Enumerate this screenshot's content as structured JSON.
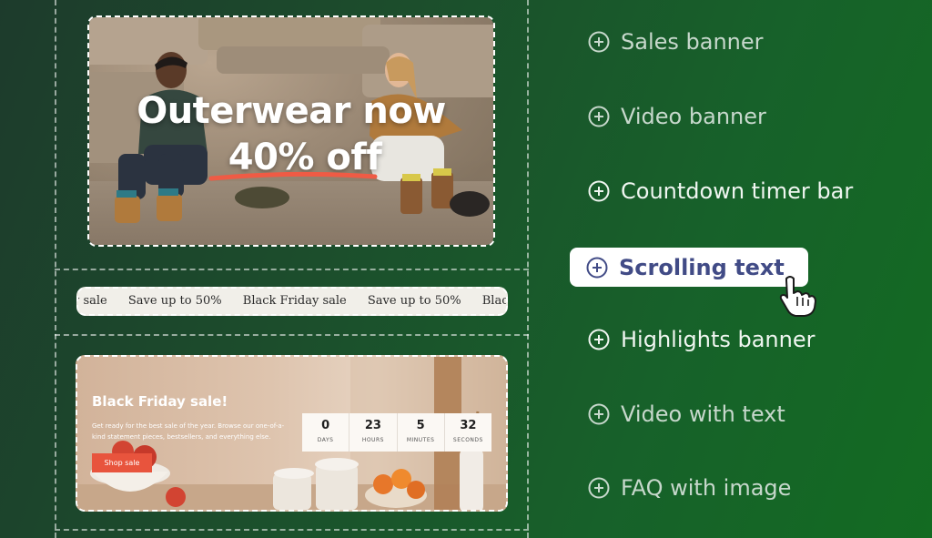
{
  "hero": {
    "line1": "Outerwear now",
    "line2": "40% off"
  },
  "ticker": {
    "items": [
      "y sale",
      "Save up to 50%",
      "Black Friday sale",
      "Save up to 50%",
      "Black Friday sale"
    ]
  },
  "promo": {
    "title": "Black Friday sale!",
    "description": "Get ready for the best sale of the year. Browse our one-of-a-kind statement pieces, bestsellers, and everything else.",
    "button_label": "Shop sale",
    "countdown": [
      {
        "value": "0",
        "unit": "DAYS"
      },
      {
        "value": "23",
        "unit": "HOURS"
      },
      {
        "value": "5",
        "unit": "MINUTES"
      },
      {
        "value": "32",
        "unit": "SECONDS"
      }
    ]
  },
  "section_menu": {
    "items": [
      {
        "label": "Sales banner",
        "icon": "plus-circle-icon"
      },
      {
        "label": "Video banner",
        "icon": "plus-circle-icon"
      },
      {
        "label": "Countdown timer bar",
        "icon": "plus-circle-icon"
      },
      {
        "label": "Scrolling text",
        "icon": "plus-circle-icon",
        "selected": true
      },
      {
        "label": "Highlights banner",
        "icon": "plus-circle-icon"
      },
      {
        "label": "Video with text",
        "icon": "plus-circle-icon"
      },
      {
        "label": "FAQ with image",
        "icon": "plus-circle-icon"
      }
    ]
  },
  "colors": {
    "accent_text": "#414b86",
    "button": "#e8543d",
    "underline": "#ef5b45"
  }
}
